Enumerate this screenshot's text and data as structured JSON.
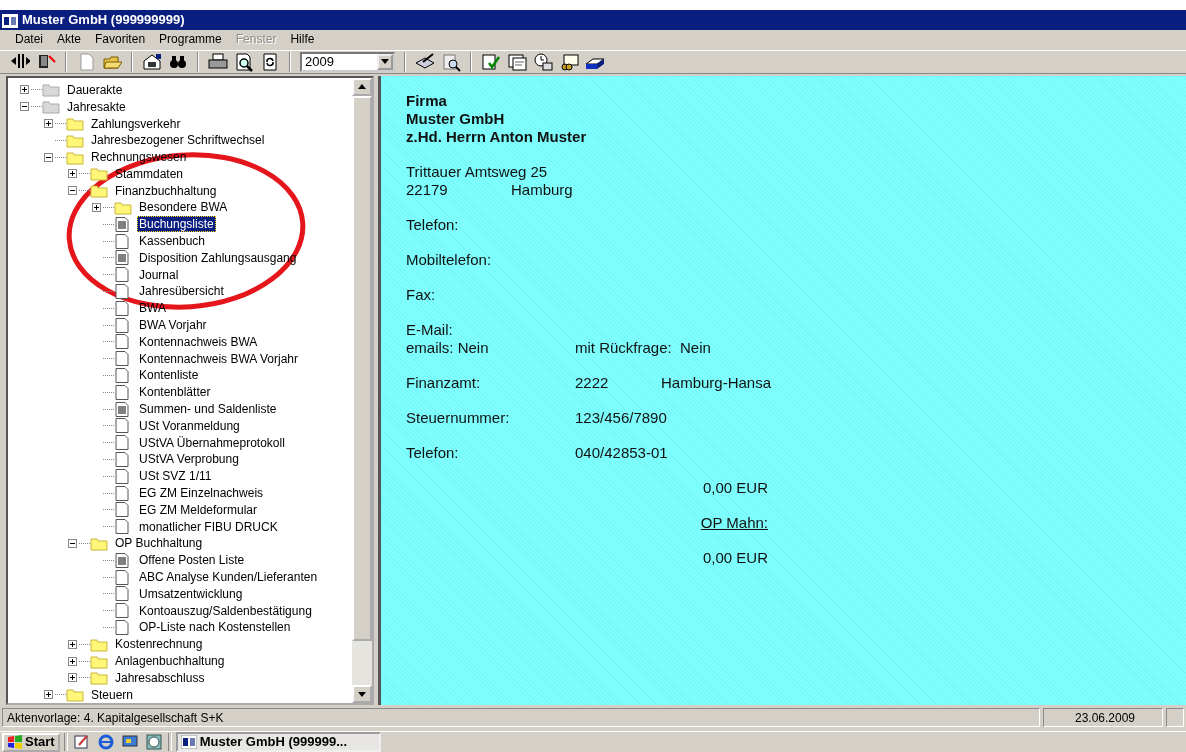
{
  "window": {
    "title": "Muster GmbH (999999999)"
  },
  "menu": [
    {
      "label": "Datei",
      "disabled": false
    },
    {
      "label": "Akte",
      "disabled": false
    },
    {
      "label": "Favoriten",
      "disabled": false
    },
    {
      "label": "Programme",
      "disabled": false
    },
    {
      "label": "Fenster",
      "disabled": true
    },
    {
      "label": "Hilfe",
      "disabled": false
    }
  ],
  "toolbar": {
    "year": "2009"
  },
  "tree": [
    {
      "label": "Dauerakte",
      "kind": "archive",
      "expanded": false,
      "selected": false
    },
    {
      "label": "Jahresakte",
      "kind": "archive",
      "expanded": true,
      "selected": false,
      "children": [
        {
          "label": "Zahlungsverkehr",
          "kind": "folder",
          "expanded": false,
          "selected": false
        },
        {
          "label": "Jahresbezogener Schriftwechsel",
          "kind": "folder",
          "selected": false
        },
        {
          "label": "Rechnungswesen",
          "kind": "folder",
          "expanded": true,
          "selected": false,
          "children": [
            {
              "label": "Stammdaten",
              "kind": "folder",
              "expanded": false,
              "selected": false
            },
            {
              "label": "Finanzbuchhaltung",
              "kind": "folder",
              "expanded": true,
              "selected": false,
              "children": [
                {
                  "label": "Besondere BWA",
                  "kind": "folder",
                  "expanded": false,
                  "selected": false
                },
                {
                  "label": "Buchungsliste",
                  "kind": "list-report",
                  "selected": true
                },
                {
                  "label": "Kassenbuch",
                  "kind": "report",
                  "selected": false
                },
                {
                  "label": "Disposition Zahlungsausgang",
                  "kind": "list-report",
                  "selected": false
                },
                {
                  "label": "Journal",
                  "kind": "report",
                  "selected": false
                },
                {
                  "label": "Jahresübersicht",
                  "kind": "report",
                  "selected": false
                },
                {
                  "label": "BWA",
                  "kind": "report",
                  "selected": false
                },
                {
                  "label": "BWA Vorjahr",
                  "kind": "report",
                  "selected": false
                },
                {
                  "label": "Kontennachweis BWA",
                  "kind": "report",
                  "selected": false
                },
                {
                  "label": "Kontennachweis BWA Vorjahr",
                  "kind": "report",
                  "selected": false
                },
                {
                  "label": "Kontenliste",
                  "kind": "report",
                  "selected": false
                },
                {
                  "label": "Kontenblätter",
                  "kind": "report",
                  "selected": false
                },
                {
                  "label": "Summen- und Saldenliste",
                  "kind": "list-report",
                  "selected": false
                },
                {
                  "label": "USt Voranmeldung",
                  "kind": "report",
                  "selected": false
                },
                {
                  "label": "UStVA Übernahmeprotokoll",
                  "kind": "report",
                  "selected": false
                },
                {
                  "label": "UStVA Verprobung",
                  "kind": "report",
                  "selected": false
                },
                {
                  "label": "USt SVZ 1/11",
                  "kind": "report",
                  "selected": false
                },
                {
                  "label": "EG ZM Einzelnachweis",
                  "kind": "report",
                  "selected": false
                },
                {
                  "label": "EG ZM Meldeformular",
                  "kind": "report",
                  "selected": false
                },
                {
                  "label": "monatlicher FIBU DRUCK",
                  "kind": "report",
                  "selected": false
                }
              ]
            },
            {
              "label": "OP Buchhaltung",
              "kind": "folder",
              "expanded": true,
              "selected": false,
              "children": [
                {
                  "label": "Offene Posten Liste",
                  "kind": "list-report",
                  "selected": false
                },
                {
                  "label": "ABC Analyse Kunden/Lieferanten",
                  "kind": "report",
                  "selected": false
                },
                {
                  "label": "Umsatzentwicklung",
                  "kind": "report",
                  "selected": false
                },
                {
                  "label": "Kontoauszug/Saldenbestätigung",
                  "kind": "report",
                  "selected": false
                },
                {
                  "label": "OP-Liste nach Kostenstellen",
                  "kind": "report",
                  "selected": false
                }
              ]
            },
            {
              "label": "Kostenrechnung",
              "kind": "folder",
              "expanded": false,
              "selected": false
            },
            {
              "label": "Anlagenbuchhaltung",
              "kind": "folder",
              "expanded": false,
              "selected": false
            },
            {
              "label": "Jahresabschluss",
              "kind": "folder",
              "expanded": false,
              "selected": false
            }
          ]
        },
        {
          "label": "Steuern",
          "kind": "folder",
          "expanded": false,
          "selected": false
        }
      ]
    }
  ],
  "detail": [
    {
      "kind": "heading",
      "lines": [
        "Firma",
        "Muster GmbH",
        "z.Hd. Herrn Anton Muster"
      ]
    },
    {
      "kind": "address",
      "street": "Trittauer Amtsweg 25",
      "zip": "22179",
      "city": "Hamburg"
    },
    {
      "kind": "field",
      "label": "Telefon:"
    },
    {
      "kind": "field",
      "label": "Mobiltelefon:"
    },
    {
      "kind": "field",
      "label": "Fax:"
    },
    {
      "kind": "email",
      "label": "E-Mail:",
      "emails": "emails: Nein",
      "confirm": "mit Rückfrage:  Nein"
    },
    {
      "kind": "field",
      "label": "Finanzamt:",
      "values": [
        "2222",
        "Hamburg-Hansa"
      ]
    },
    {
      "kind": "field",
      "label": "Steuernummer:",
      "values": [
        "123/456/7890"
      ]
    },
    {
      "kind": "field",
      "label": "Telefon:",
      "values": [
        "040/42853-01"
      ]
    },
    {
      "kind": "amount",
      "text": "0,00 EUR"
    },
    {
      "kind": "link",
      "text": "OP Mahn:"
    },
    {
      "kind": "amount",
      "text": "0,00 EUR"
    }
  ],
  "status_bar": {
    "template": "Aktenvorlage: 4. Kapitalgesellschaft S+K",
    "date": "23.06.2009"
  },
  "taskbar": {
    "start": "Start",
    "tasks": [
      {
        "label": "Muster GmbH (999999...",
        "selected": true
      }
    ]
  }
}
